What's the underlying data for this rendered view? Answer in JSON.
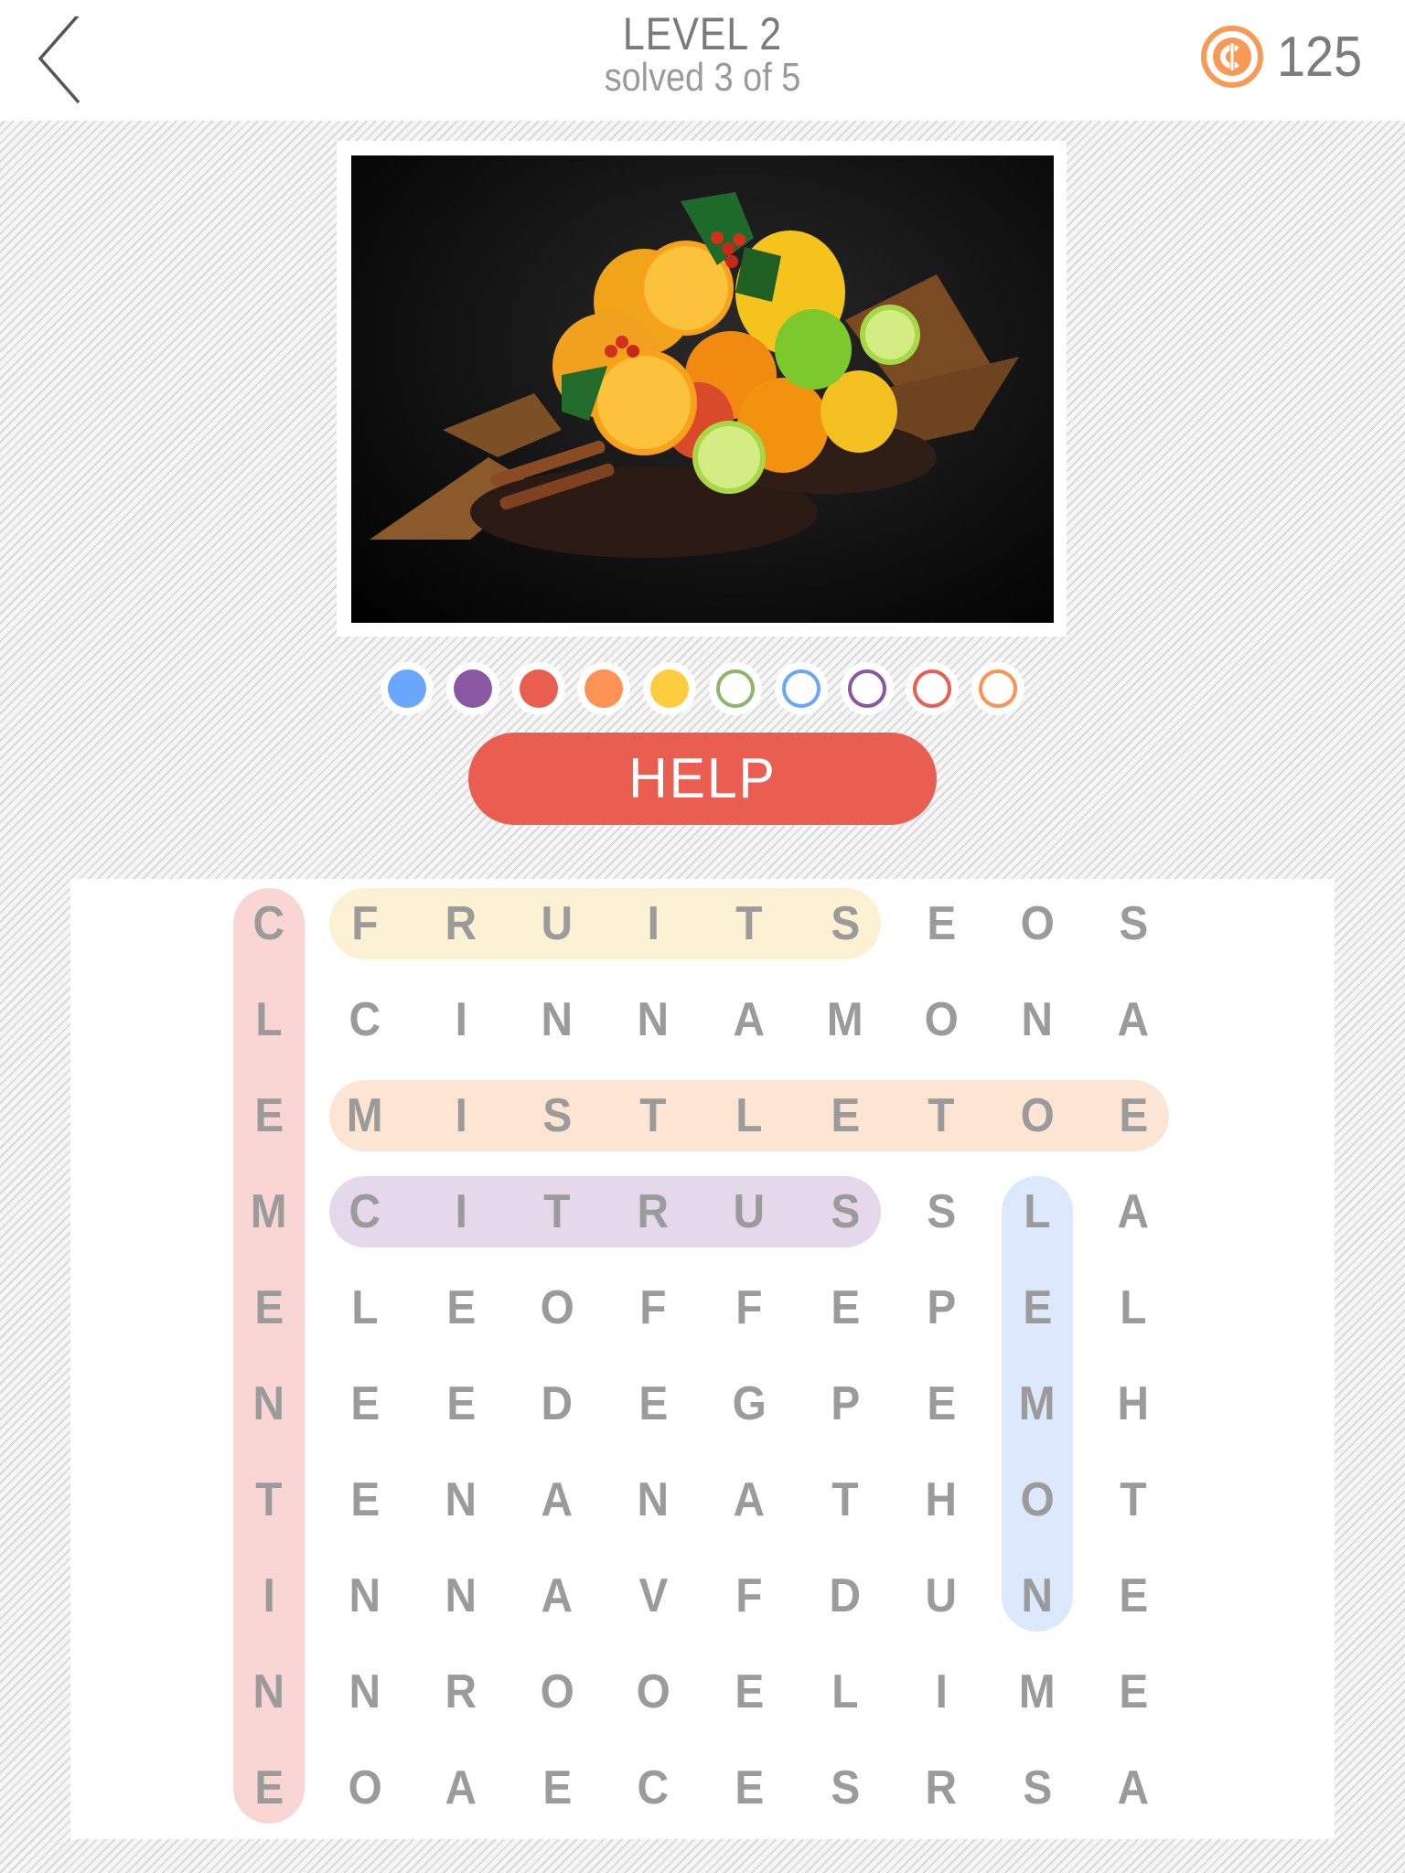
{
  "header": {
    "back_icon": "chevron-left-icon",
    "level_title": "LEVEL 2",
    "progress_text": "solved 3 of 5",
    "coin_icon": "coin-icon",
    "coins": "125",
    "coin_color": "#f79a55"
  },
  "puzzle_image": {
    "description": "Citrus fruits (oranges, lemons, limes), holly with red berries, cinnamon sticks, dried autumn leaves and dried tea on black background"
  },
  "progress_dots": [
    {
      "state": "filled",
      "color": "#6aa6fb"
    },
    {
      "state": "filled",
      "color": "#8a58a3"
    },
    {
      "state": "filled",
      "color": "#e95e50"
    },
    {
      "state": "filled",
      "color": "#fc9354"
    },
    {
      "state": "filled",
      "color": "#fdcc3f"
    },
    {
      "state": "empty",
      "color": "#8eb56e"
    },
    {
      "state": "empty",
      "color": "#6aa6fb"
    },
    {
      "state": "empty",
      "color": "#8a58a3"
    },
    {
      "state": "empty",
      "color": "#e95e50"
    },
    {
      "state": "empty",
      "color": "#fc9354"
    }
  ],
  "help_button": {
    "label": "HELP",
    "color": "#e95e50"
  },
  "grid": {
    "rows": [
      [
        "C",
        "F",
        "R",
        "U",
        "I",
        "T",
        "S",
        "E",
        "O",
        "S"
      ],
      [
        "L",
        "C",
        "I",
        "N",
        "N",
        "A",
        "M",
        "O",
        "N",
        "A"
      ],
      [
        "E",
        "M",
        "I",
        "S",
        "T",
        "L",
        "E",
        "T",
        "O",
        "E"
      ],
      [
        "M",
        "C",
        "I",
        "T",
        "R",
        "U",
        "S",
        "S",
        "L",
        "A"
      ],
      [
        "E",
        "L",
        "E",
        "O",
        "F",
        "F",
        "E",
        "P",
        "E",
        "L"
      ],
      [
        "N",
        "E",
        "E",
        "D",
        "E",
        "G",
        "P",
        "E",
        "M",
        "H"
      ],
      [
        "T",
        "E",
        "N",
        "A",
        "N",
        "A",
        "T",
        "H",
        "O",
        "T"
      ],
      [
        "I",
        "N",
        "N",
        "A",
        "V",
        "F",
        "D",
        "U",
        "N",
        "E"
      ],
      [
        "N",
        "N",
        "R",
        "O",
        "O",
        "E",
        "L",
        "I",
        "M",
        "E"
      ],
      [
        "E",
        "O",
        "A",
        "E",
        "C",
        "E",
        "S",
        "R",
        "S",
        "A"
      ]
    ]
  },
  "found_words": [
    {
      "word": "CLEMENTINE",
      "start": [
        0,
        0
      ],
      "end": [
        9,
        0
      ],
      "direction": "vertical",
      "color": "#f9d6d3"
    },
    {
      "word": "FRUITS",
      "start": [
        0,
        1
      ],
      "end": [
        0,
        6
      ],
      "direction": "horizontal",
      "color": "#fdf1d3"
    },
    {
      "word": "MISTLETOE",
      "start": [
        2,
        1
      ],
      "end": [
        2,
        9
      ],
      "direction": "horizontal",
      "color": "#fde5d4"
    },
    {
      "word": "CITRUS",
      "start": [
        3,
        1
      ],
      "end": [
        3,
        6
      ],
      "direction": "horizontal",
      "color": "#e5d8ea"
    },
    {
      "word": "LEMON",
      "start": [
        3,
        8
      ],
      "end": [
        7,
        8
      ],
      "direction": "vertical",
      "color": "#dce8fb"
    }
  ]
}
